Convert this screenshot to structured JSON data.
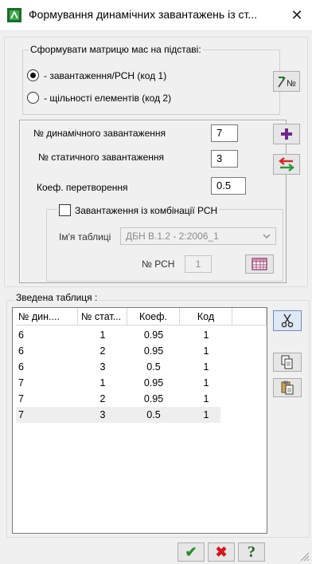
{
  "window": {
    "title": "Формування динамічних завантажень із ст...",
    "close_glyph": "✕"
  },
  "mass_matrix": {
    "legend": "Сформувати матрицю мас на підставі:",
    "options": [
      {
        "label": "- завантаження/РСН (код 1)",
        "selected": true
      },
      {
        "label": "- щільності елементів (код 2)",
        "selected": false
      }
    ]
  },
  "params": {
    "dynamic_label": "№  динамічного завантаження",
    "dynamic_value": "7",
    "static_label": "№  статичного завантаження",
    "static_value": "3",
    "coef_label": "Коеф. перетворення",
    "coef_value": "0.5"
  },
  "combination": {
    "checkbox_label": "Завантаження із комбінації РСН",
    "checked": false,
    "table_name_label": "Ім'я таблиці",
    "table_name_value": "ДБН В.1.2 - 2:2006_1",
    "rsn_label": "№ РСН",
    "rsn_value": "1"
  },
  "summary_table": {
    "caption": "Зведена таблиця :",
    "columns": [
      "№ дин....",
      "№ стат...",
      "Коеф.",
      "Код"
    ],
    "rows": [
      [
        "6",
        "1",
        "0.95",
        "1"
      ],
      [
        "6",
        "2",
        "0.95",
        "1"
      ],
      [
        "6",
        "3",
        "0.5",
        "1"
      ],
      [
        "7",
        "1",
        "0.95",
        "1"
      ],
      [
        "7",
        "2",
        "0.95",
        "1"
      ],
      [
        "7",
        "3",
        "0.5",
        "1"
      ]
    ],
    "selected_row": 5
  },
  "colors": {
    "add_icon": "#6d2a8a",
    "ok_icon": "#2e8b2e",
    "cancel_icon": "#d11a1a",
    "help_icon": "#2a5d2a",
    "swap_red": "#d22a2a",
    "swap_green": "#2a9a3a"
  },
  "bottom_buttons": {
    "ok_glyph": "✔",
    "cancel_glyph": "✖",
    "help_glyph": "?"
  }
}
